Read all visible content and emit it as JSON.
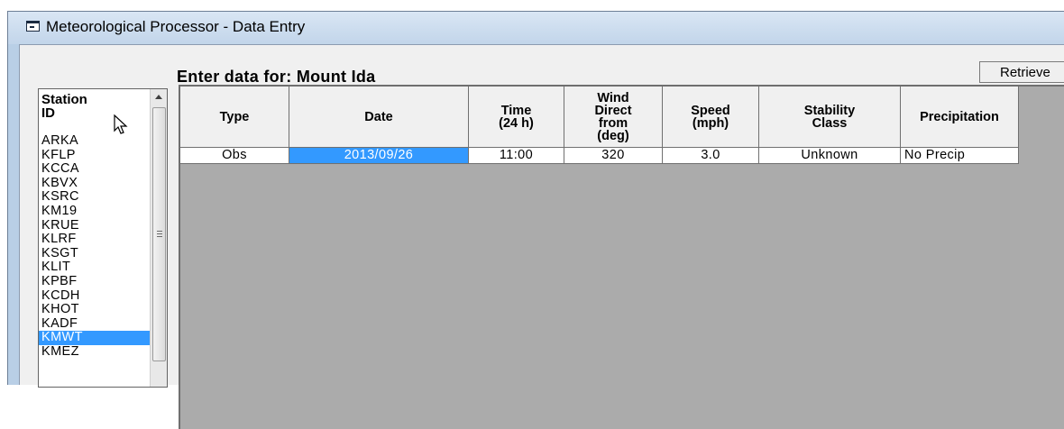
{
  "window": {
    "title": "Meteorological Processor - Data Entry"
  },
  "heading": "Enter data for: Mount Ida",
  "retrieve_label": "Retrieve",
  "station_list": {
    "header": "Station\nID",
    "items": [
      "ARKA",
      "KFLP",
      "KCCA",
      "KBVX",
      "KSRC",
      "KM19",
      "KRUE",
      "KLRF",
      "KSGT",
      "KLIT",
      "KPBF",
      "KCDH",
      "KHOT",
      "KADF",
      "KMWT",
      "KMEZ"
    ],
    "selected": "KMWT"
  },
  "grid": {
    "columns": [
      "Type",
      "Date",
      "Time\n(24 h)",
      "Wind\nDirect\nfrom\n(deg)",
      "Speed\n(mph)",
      "Stability\nClass",
      "Precipitation"
    ],
    "rows": [
      [
        "Obs",
        "2013/09/26",
        "11:00",
        "320",
        "3.0",
        "Unknown",
        "No Precip"
      ]
    ]
  },
  "colors": {
    "selection": "#3399ff",
    "grid_background": "#ababab",
    "titlebar": "#c9daee"
  }
}
